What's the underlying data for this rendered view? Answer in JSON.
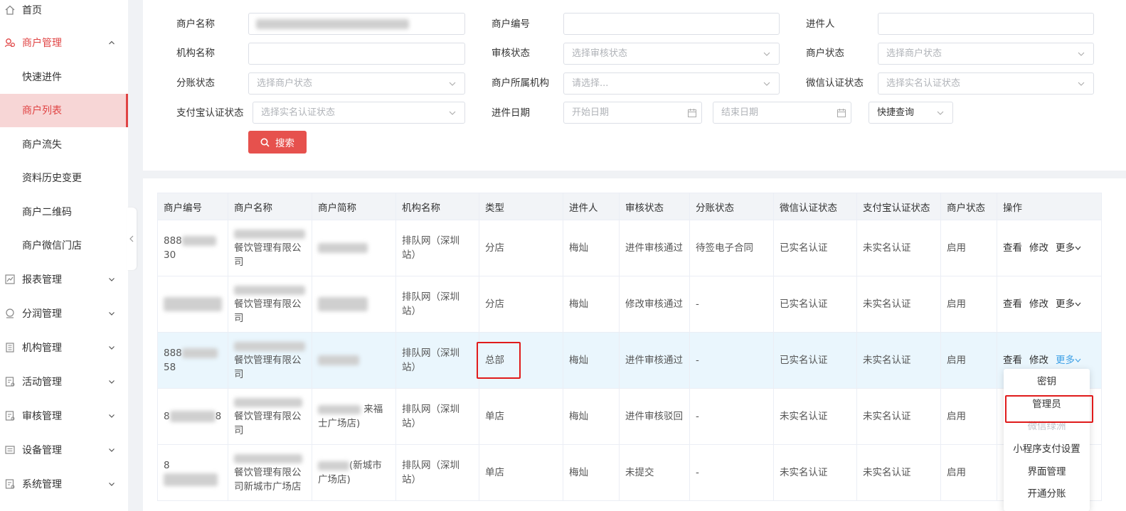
{
  "sidebar": {
    "home": "首页",
    "merchant_mgmt": "商户管理",
    "sub": [
      "快速进件",
      "商户列表",
      "商户流失",
      "资料历史变更",
      "商户二维码",
      "商户微信门店"
    ],
    "groups": [
      "报表管理",
      "分润管理",
      "机构管理",
      "活动管理",
      "审核管理",
      "设备管理",
      "系统管理"
    ]
  },
  "filters": {
    "merchant_name": "商户名称",
    "merchant_no": "商户编号",
    "applicant": "进件人",
    "org_name": "机构名称",
    "audit_status": "审核状态",
    "audit_status_ph": "选择审核状态",
    "merchant_status": "商户状态",
    "merchant_status_ph": "选择商户状态",
    "split_status": "分账状态",
    "split_status_ph": "选择商户状态",
    "owner_org": "商户所属机构",
    "owner_org_ph": "请选择...",
    "wechat_auth": "微信认证状态",
    "wechat_auth_ph": "选择实名认证状态",
    "alipay_auth": "支付宝认证状态",
    "alipay_auth_ph": "选择实名认证状态",
    "date": "进件日期",
    "start_ph": "开始日期",
    "end_ph": "结束日期",
    "quick": "快捷查询",
    "search_btn": "搜索"
  },
  "table": {
    "headers": [
      "商户编号",
      "商户名称",
      "商户简称",
      "机构名称",
      "类型",
      "进件人",
      "审核状态",
      "分账状态",
      "微信认证状态",
      "支付宝认证状态",
      "商户状态",
      "操作"
    ],
    "rows": [
      {
        "no_a": "888",
        "no_b": "30",
        "name": "餐饮管理有限公司",
        "short_a": "",
        "org": "排队网（深圳站）",
        "type": "分店",
        "applicant": "梅灿",
        "audit": "进件审核通过",
        "split": "待签电子合同",
        "wx": "已实名认证",
        "ali": "未实名认证",
        "status": "启用"
      },
      {
        "no_a": "",
        "no_b": "",
        "name": "餐饮管理有限公司",
        "short_a": "",
        "org": "排队网（深圳站）",
        "type": "分店",
        "applicant": "梅灿",
        "audit": "修改审核通过",
        "split": "-",
        "wx": "已实名认证",
        "ali": "未实名认证",
        "status": "启用"
      },
      {
        "no_a": "888",
        "no_b": "58",
        "name": "餐饮管理有限公司",
        "short_a": "",
        "org": "排队网（深圳站）",
        "type": "总部",
        "applicant": "梅灿",
        "audit": "进件审核通过",
        "split": "-",
        "wx": "已实名认证",
        "ali": "未实名认证",
        "status": "启用"
      },
      {
        "no_a": "8",
        "no_b": "8",
        "name": "餐饮管理有限公司",
        "short_a": "来福士广场店)",
        "org": "排队网（深圳站）",
        "type": "单店",
        "applicant": "梅灿",
        "audit": "进件审核驳回",
        "split": "-",
        "wx": "未实名认证",
        "ali": "未实名认证",
        "status": "启用"
      },
      {
        "no_a": "8",
        "no_b": "",
        "name": "餐饮管理有限公司新城市广场店",
        "short_a": "(新城市广场店)",
        "org": "排队网（深圳站）",
        "type": "单店",
        "applicant": "梅灿",
        "audit": "未提交",
        "split": "-",
        "wx": "未实名认证",
        "ali": "未实名认证",
        "status": "启用"
      }
    ],
    "op_view": "查看",
    "op_edit": "修改",
    "op_more": "更多"
  },
  "dropdown": [
    "密钥",
    "管理员",
    "微信绿洲",
    "小程序支付设置",
    "界面管理",
    "开通分账"
  ],
  "colors": {
    "accent": "#e04444",
    "link": "#3ea0e6",
    "warning": "#f0a020"
  }
}
